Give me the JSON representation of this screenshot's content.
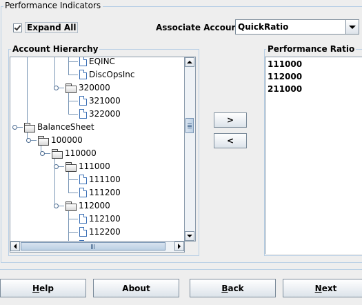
{
  "panel": {
    "title": "Performance Indicators"
  },
  "expand_all": {
    "label": "Expand All",
    "checked": true
  },
  "associate": {
    "label": "Associate Account",
    "selected": "QuickRatio"
  },
  "hierarchy": {
    "title": "Account Hierarchy",
    "nodes": [
      {
        "label": "EQINC",
        "type": "file",
        "depth": 4
      },
      {
        "label": "DiscOpsInc",
        "type": "file",
        "depth": 4
      },
      {
        "label": "320000",
        "type": "folder",
        "depth": 3,
        "expanded": true
      },
      {
        "label": "321000",
        "type": "file",
        "depth": 4
      },
      {
        "label": "322000",
        "type": "file",
        "depth": 4
      },
      {
        "label": "BalanceSheet",
        "type": "folder",
        "depth": 0,
        "expanded": true
      },
      {
        "label": "100000",
        "type": "folder",
        "depth": 1,
        "expanded": true
      },
      {
        "label": "110000",
        "type": "folder",
        "depth": 2,
        "expanded": true
      },
      {
        "label": "111000",
        "type": "folder",
        "depth": 3,
        "expanded": true
      },
      {
        "label": "111100",
        "type": "file",
        "depth": 4
      },
      {
        "label": "111200",
        "type": "file",
        "depth": 4
      },
      {
        "label": "112000",
        "type": "folder",
        "depth": 3,
        "expanded": true
      },
      {
        "label": "112100",
        "type": "file",
        "depth": 4
      },
      {
        "label": "112200",
        "type": "file",
        "depth": 4
      },
      {
        "label": "",
        "type": "file",
        "depth": 4
      }
    ]
  },
  "move": {
    "add_label": ">",
    "remove_label": "<"
  },
  "ratio": {
    "title": "Performance Ratio",
    "items": [
      "111000",
      "112000",
      "211000"
    ]
  },
  "footer": {
    "help": {
      "first": "H",
      "rest": "elp"
    },
    "about": {
      "first": "A",
      "rest": "bout"
    },
    "back": {
      "first": "B",
      "rest": "ack"
    },
    "next": {
      "first": "N",
      "rest": "ext"
    }
  }
}
